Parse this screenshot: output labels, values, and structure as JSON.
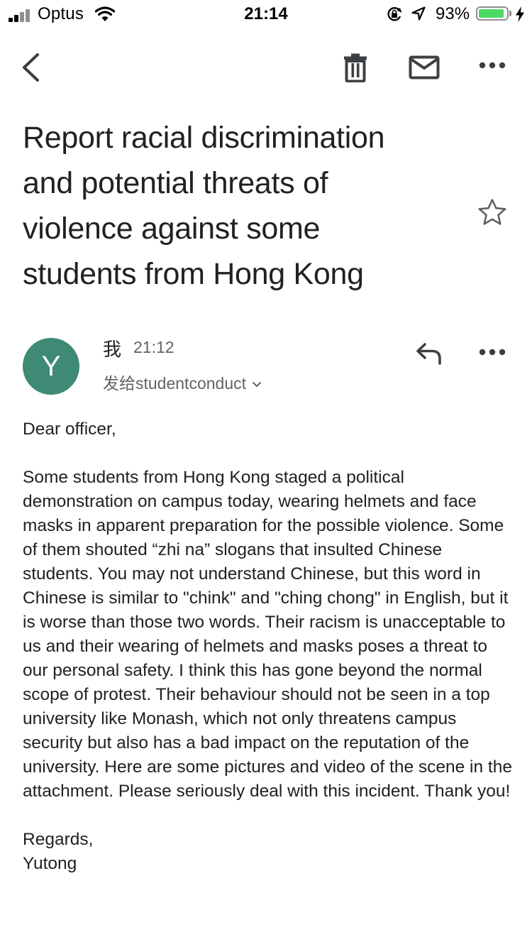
{
  "status_bar": {
    "carrier": "Optus",
    "time": "21:14",
    "battery_percent_label": "93%",
    "battery_level": 0.93,
    "icons": [
      "signal-icon",
      "wifi-icon",
      "orientation-lock-icon",
      "location-icon",
      "battery-icon",
      "charging-bolt-icon"
    ]
  },
  "toolbar": {
    "icons": [
      "back-arrow-icon",
      "trash-icon",
      "mail-icon",
      "more-options-icon"
    ]
  },
  "email": {
    "subject": "Report racial discrimination and potential threats of violence against some students from Hong Kong",
    "starred": false,
    "sender": {
      "avatar_letter": "Y",
      "avatar_color": "#3e8a74",
      "name": "我",
      "time": "21:12",
      "recipient_line": "发给studentconduct"
    },
    "body": {
      "greeting": "Dear officer,",
      "paragraph": "Some students from Hong Kong staged a political demonstration on campus today, wearing helmets and face masks in apparent preparation for the possible violence. Some of them shouted “zhi na” slogans that insulted Chinese students. You may not understand Chinese, but this word in Chinese is similar to \"chink\" and \"ching chong\" in English, but it is worse than those two words. Their racism is unacceptable to us and their wearing of helmets and masks poses a threat to our personal safety. I think this has gone beyond the normal scope of protest. Their behaviour should not be seen in a top university like Monash, which not only threatens campus security but also has a bad impact on the reputation of the university. Here are some pictures and video of the scene in the attachment. Please seriously deal with this incident. Thank you!",
      "closing": "Regards,",
      "signature": "Yutong"
    }
  },
  "colors": {
    "text_primary": "#202124",
    "text_secondary": "#5f6368",
    "battery_green": "#4cd964"
  }
}
